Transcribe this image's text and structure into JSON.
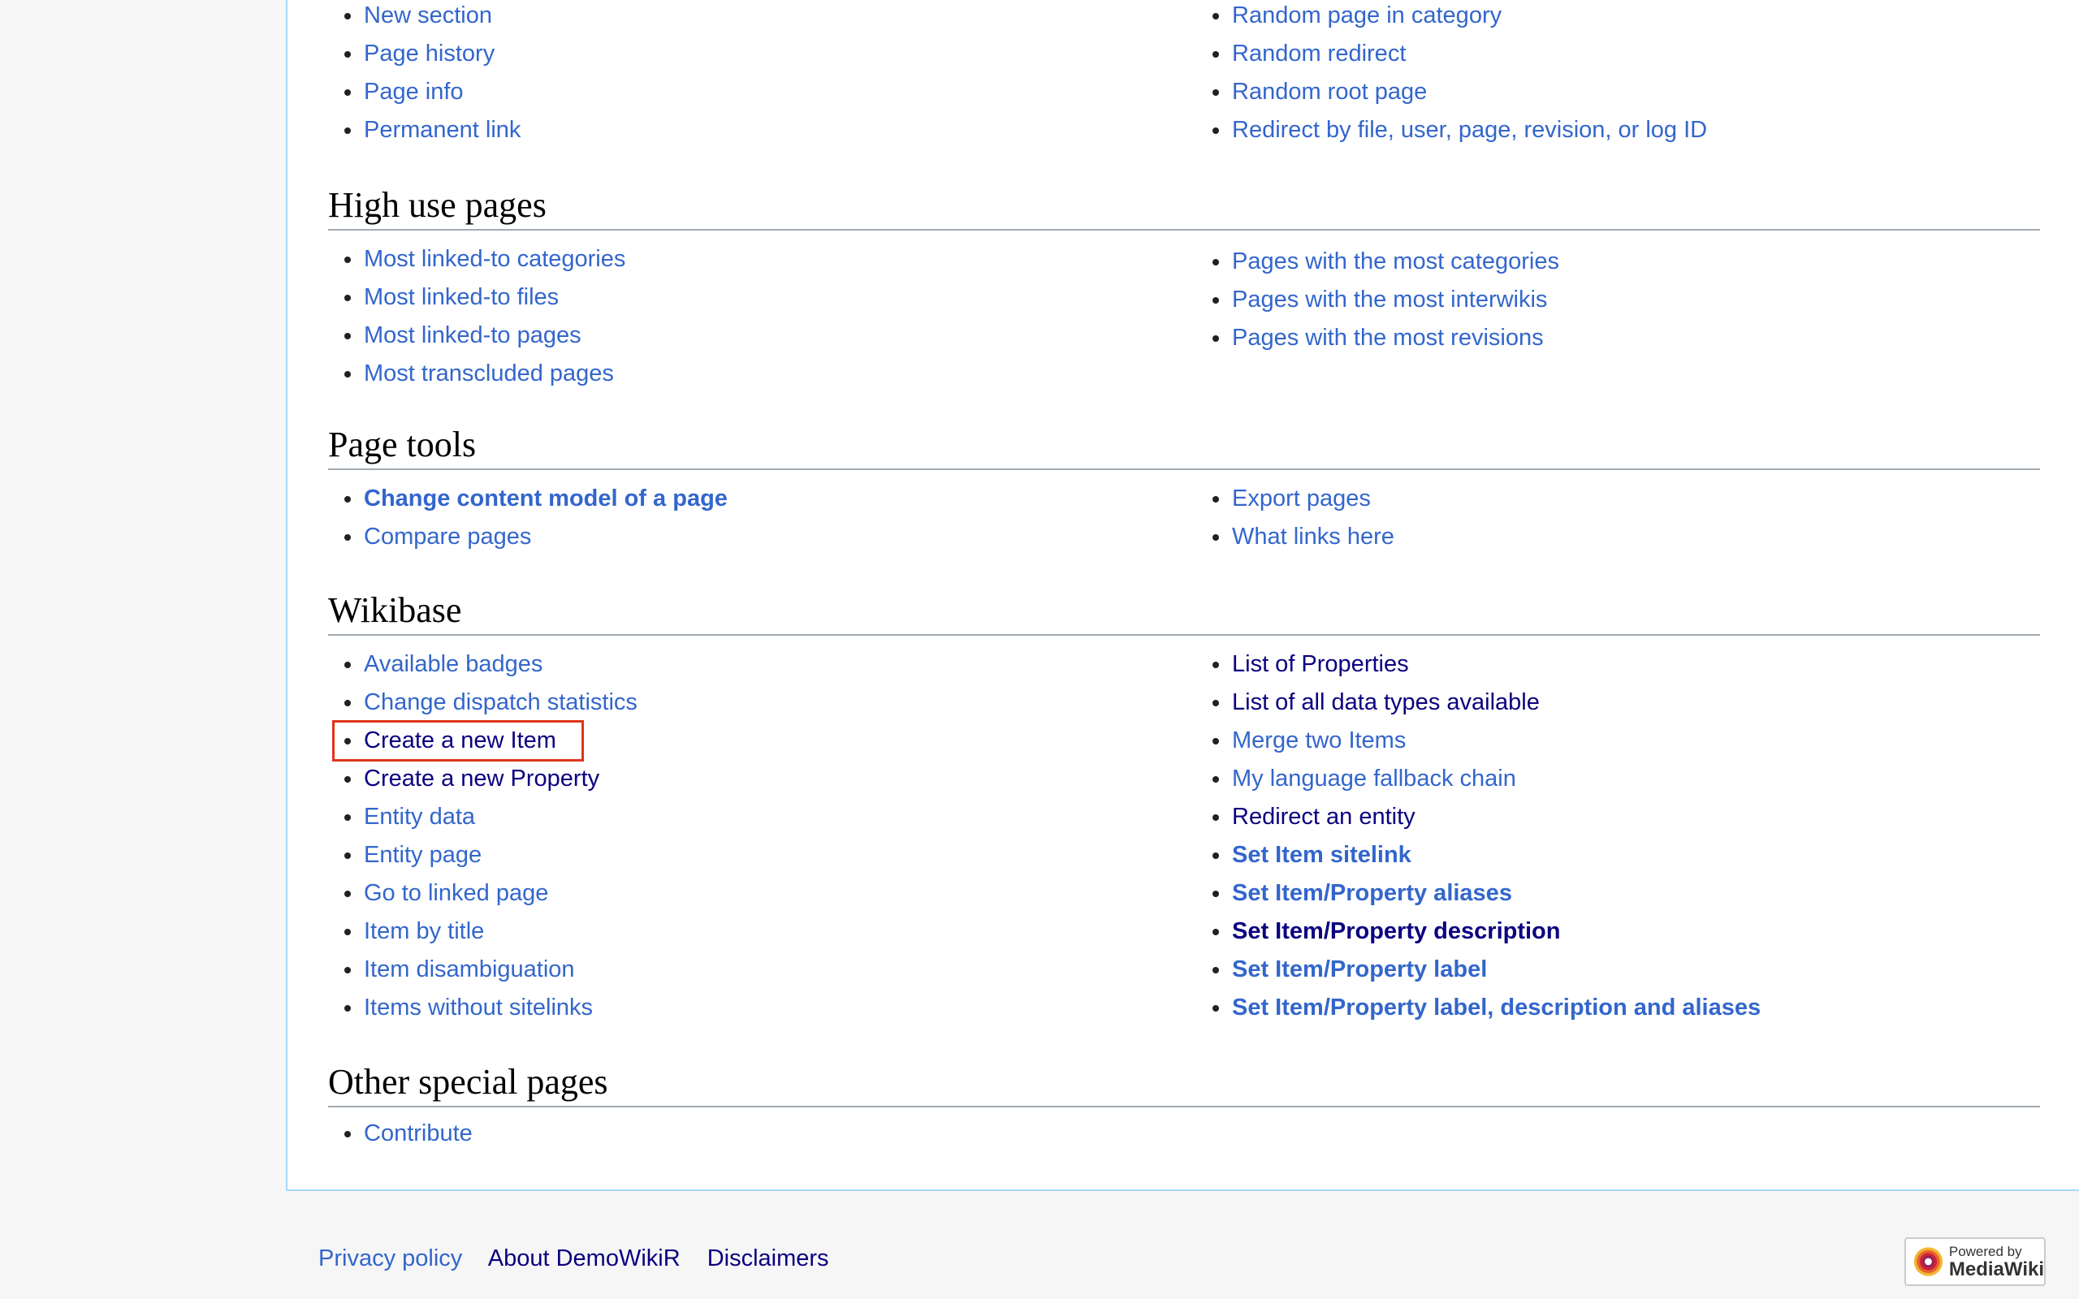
{
  "sections": {
    "top": {
      "left": [
        "New section",
        "Page history",
        "Page info",
        "Permanent link"
      ],
      "right": [
        "Random page in category",
        "Random redirect",
        "Random root page",
        "Redirect by file, user, page, revision, or log ID"
      ]
    },
    "high_use": {
      "title": "High use pages",
      "left": [
        "Most linked-to categories",
        "Most linked-to files",
        "Most linked-to pages",
        "Most transcluded pages"
      ],
      "right": [
        "Pages with the most categories",
        "Pages with the most interwikis",
        "Pages with the most revisions"
      ]
    },
    "page_tools": {
      "title": "Page tools",
      "left": [
        "Change content model of a page",
        "Compare pages"
      ],
      "right": [
        "Export pages",
        "What links here"
      ]
    },
    "wikibase": {
      "title": "Wikibase",
      "left": [
        "Available badges",
        "Change dispatch statistics",
        "Create a new Item",
        "Create a new Property",
        "Entity data",
        "Entity page",
        "Go to linked page",
        "Item by title",
        "Item disambiguation",
        "Items without sitelinks"
      ],
      "right": [
        "List of Properties",
        "List of all data types available",
        "Merge two Items",
        "My language fallback chain",
        "Redirect an entity",
        "Set Item sitelink",
        "Set Item/Property aliases",
        "Set Item/Property description",
        "Set Item/Property label",
        "Set Item/Property label, description and aliases"
      ]
    },
    "other": {
      "title": "Other special pages",
      "left": [
        "Contribute"
      ]
    }
  },
  "footer": {
    "links": [
      "Privacy policy",
      "About DemoWikiR",
      "Disclaimers"
    ],
    "powered_small": "Powered by",
    "powered_big": "MediaWiki"
  },
  "colors": {
    "link": "#3366cc",
    "visited": "#0b0080",
    "highlight": "#e0341a",
    "rule": "#a2a9b1"
  }
}
